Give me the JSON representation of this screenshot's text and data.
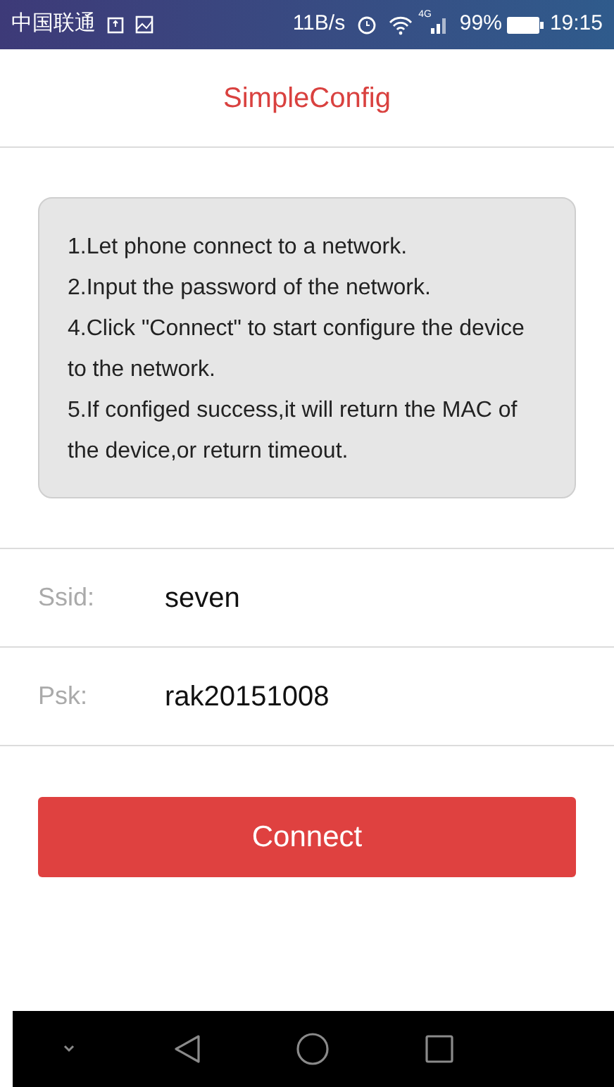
{
  "status_bar": {
    "carrier": "中国联通",
    "speed": "11B/s",
    "network": "4G",
    "battery": "99%",
    "time": "19:15"
  },
  "title": "SimpleConfig",
  "instructions": [
    "1.Let phone connect to a network.",
    "2.Input the password of the network.",
    "4.Click \"Connect\" to start configure the device to the network.",
    "5.If configed success,it will return the MAC of the device,or return timeout."
  ],
  "fields": [
    {
      "label": "Ssid:",
      "value": "seven"
    },
    {
      "label": "Psk:",
      "value": "rak20151008"
    }
  ],
  "connect_button": "Connect"
}
